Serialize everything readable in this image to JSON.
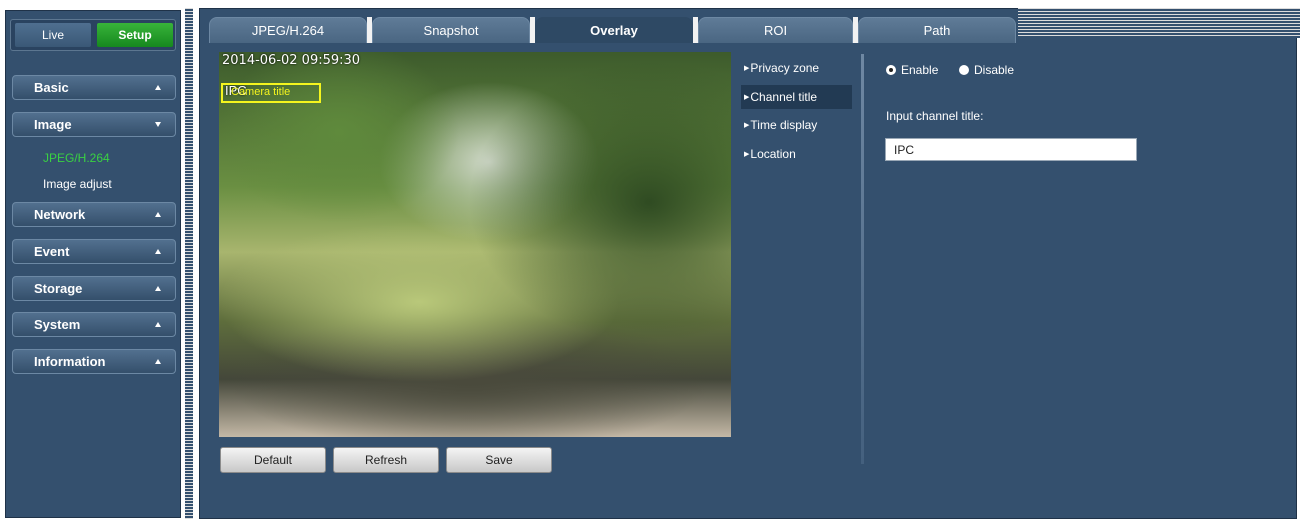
{
  "mode": {
    "live": "Live",
    "setup": "Setup"
  },
  "sidebar": {
    "basic": "Basic",
    "image": "Image",
    "image_sub": [
      "JPEG/H.264",
      "Image adjust"
    ],
    "network": "Network",
    "event": "Event",
    "storage": "Storage",
    "system": "System",
    "information": "Information"
  },
  "tabs": [
    "JPEG/H.264",
    "Snapshot",
    "Overlay",
    "ROI",
    "Path"
  ],
  "active_tab": "Overlay",
  "video": {
    "timestamp": "2014-06-02 09:59:30",
    "channel_title_overlay": "IPC",
    "camera_title_label": "Camera title"
  },
  "buttons": {
    "default": "Default",
    "refresh": "Refresh",
    "save": "Save"
  },
  "overlay_menu": [
    "Privacy zone",
    "Channel title",
    "Time display",
    "Location"
  ],
  "overlay_selected": "Channel title",
  "settings": {
    "enable_label": "Enable",
    "disable_label": "Disable",
    "enabled": true,
    "input_label": "Input channel title:",
    "channel_title_value": "IPC"
  },
  "colors": {
    "accent_green": "#39d142",
    "panel_bg": "#34506e",
    "highlight_yellow": "#f5f51e"
  }
}
